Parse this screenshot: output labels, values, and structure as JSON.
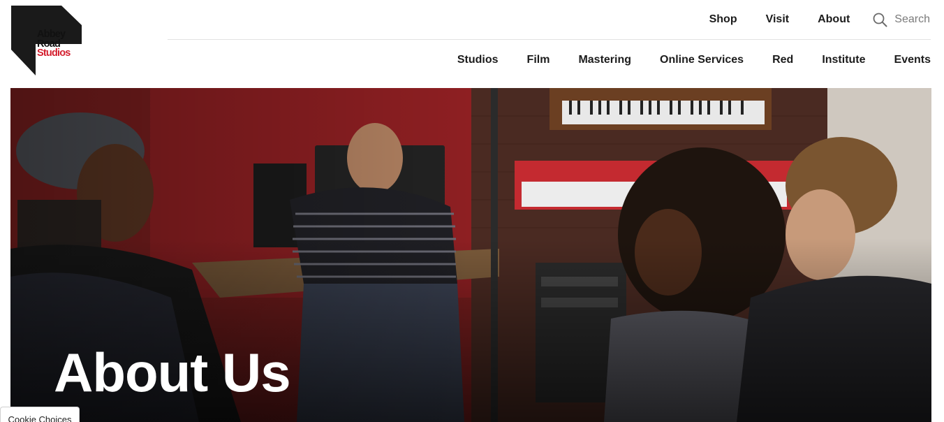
{
  "brand": {
    "line1": "Abbey",
    "line2": "Road",
    "line3": "Studios",
    "accent_color": "#d41f2f"
  },
  "top_nav": {
    "items": [
      {
        "label": "Shop"
      },
      {
        "label": "Visit"
      },
      {
        "label": "About"
      }
    ],
    "search": {
      "label": "Search",
      "icon": "search-icon"
    }
  },
  "main_nav": {
    "items": [
      {
        "label": "Studios"
      },
      {
        "label": "Film"
      },
      {
        "label": "Mastering"
      },
      {
        "label": "Online Services"
      },
      {
        "label": "Red"
      },
      {
        "label": "Institute"
      },
      {
        "label": "Events"
      }
    ]
  },
  "hero": {
    "title": "About Us"
  },
  "cookie": {
    "label": "Cookie Choices"
  }
}
